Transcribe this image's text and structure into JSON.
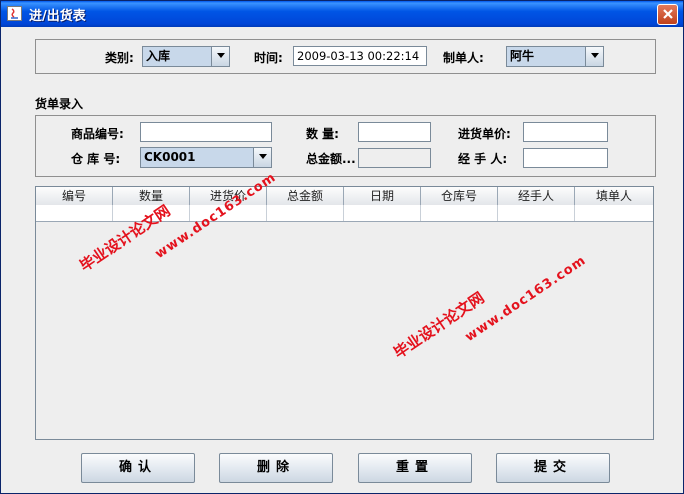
{
  "window": {
    "title": "进/出货表"
  },
  "header": {
    "category_label": "类别:",
    "category_value": "入库",
    "time_label": "时间:",
    "time_value": "2009-03-13 00:22:14",
    "maker_label": "制单人:",
    "maker_value": "阿牛"
  },
  "entry": {
    "section_title": "货单录入",
    "product_code_label": "商品编号:",
    "product_code_value": "",
    "quantity_label": "数  量:",
    "quantity_value": "",
    "unit_price_label": "进货单价:",
    "unit_price_value": "",
    "warehouse_label": "仓 库 号:",
    "warehouse_value": "CK0001",
    "total_label": "总金额...",
    "total_value": "",
    "handler_label": "经 手 人:",
    "handler_value": ""
  },
  "table": {
    "columns": [
      "编号",
      "数量",
      "进货价",
      "总金额",
      "日期",
      "仓库号",
      "经手人",
      "填单人"
    ],
    "rows": [
      [
        "",
        "",
        "",
        "",
        "",
        "",
        "",
        ""
      ]
    ]
  },
  "buttons": {
    "confirm": "确认",
    "delete": "删除",
    "reset": "重置",
    "submit": "提交"
  },
  "watermark": {
    "line1": "毕业设计论文网",
    "line2": "www.doc163.com"
  },
  "colors": {
    "titlebar": "#0055e5",
    "watermark": "#e4121d",
    "combo_bg": "#c8d8ea"
  }
}
